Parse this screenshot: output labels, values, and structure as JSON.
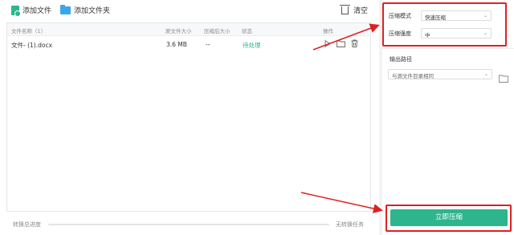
{
  "toolbar": {
    "add_file_label": "添加文件",
    "add_folder_label": "添加文件夹",
    "clear_label": "清空"
  },
  "table": {
    "headers": {
      "name": "文件名称（1）",
      "orig_size": "原文件大小",
      "comp_size": "压缩后大小",
      "status": "状态",
      "ops": "操作"
    },
    "rows": [
      {
        "name": "文件- (1).docx",
        "orig_size": "3.6 MB",
        "comp_size": "--",
        "status": "待处理"
      }
    ]
  },
  "progress": {
    "label": "转换总进度",
    "status": "无转换任务",
    "value": 0
  },
  "settings": {
    "mode_label": "压缩模式",
    "mode_value": "快速压缩",
    "strength_label": "压缩强度",
    "strength_value": "中",
    "output_label": "输出路径",
    "output_value": "与源文件目录相同"
  },
  "action": {
    "start_label": "立即压缩"
  },
  "colors": {
    "accent": "#2db58d",
    "highlight": "#e02020"
  }
}
